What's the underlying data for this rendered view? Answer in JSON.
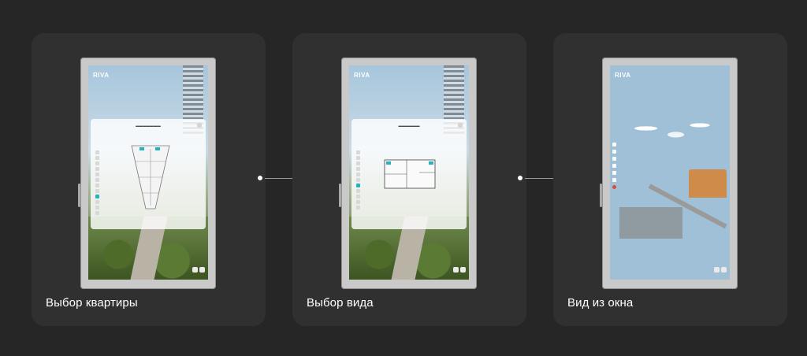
{
  "cards": [
    {
      "label": "Выбор квартиры",
      "logo": "RIVA"
    },
    {
      "label": "Выбор вида",
      "logo": "RIVA"
    },
    {
      "label": "Вид из окна",
      "logo": "RIVA"
    }
  ],
  "colors": {
    "background": "#262626",
    "card": "#303030",
    "accent": "#27b2c1",
    "label": "#ffffff"
  }
}
